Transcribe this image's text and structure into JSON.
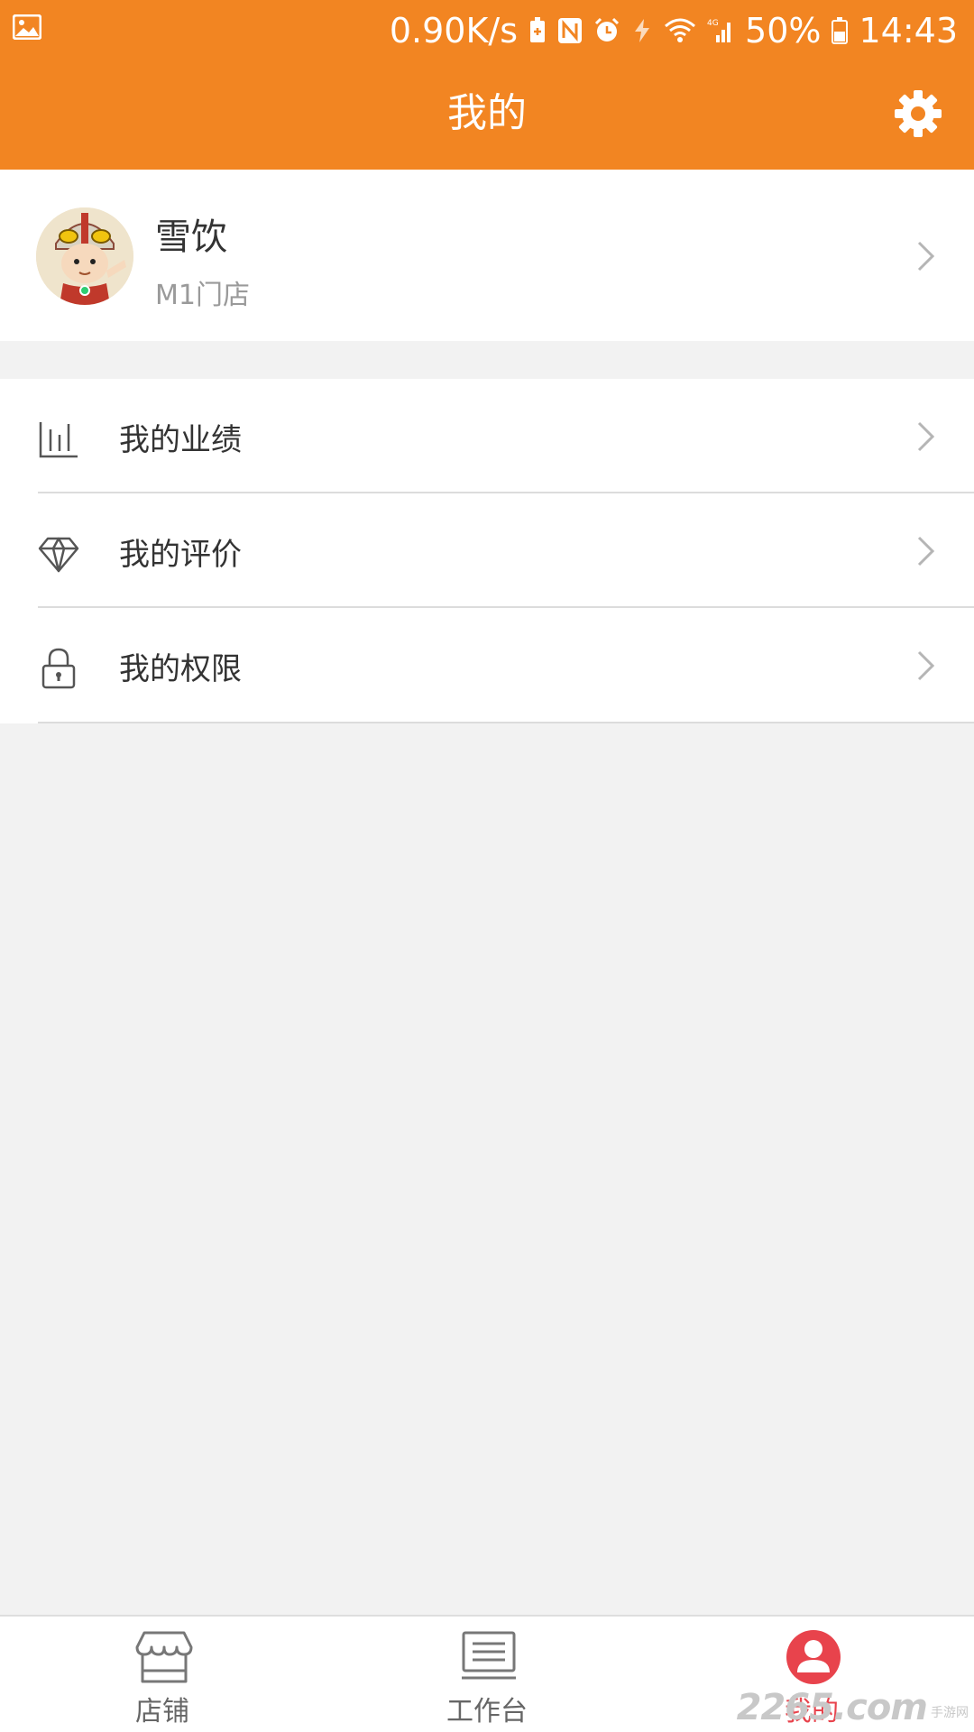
{
  "status_bar": {
    "speed": "0.90K/s",
    "battery_percent": "50%",
    "time": "14:43",
    "network": "4G",
    "icons": [
      "image-icon",
      "battery-saver-icon",
      "nfc-icon",
      "alarm-icon",
      "data-saver-icon",
      "wifi-icon",
      "signal-icon",
      "battery-icon"
    ]
  },
  "header": {
    "title": "我的",
    "settings_icon": "gear-icon",
    "background_color": "#f28522"
  },
  "profile": {
    "name": "雪饮",
    "store": "M1门店"
  },
  "menu": [
    {
      "label": "我的业绩",
      "icon": "bar-chart-icon"
    },
    {
      "label": "我的评价",
      "icon": "diamond-icon"
    },
    {
      "label": "我的权限",
      "icon": "lock-icon"
    }
  ],
  "bottom_nav": {
    "items": [
      {
        "label": "店铺",
        "icon": "store-icon",
        "active": false
      },
      {
        "label": "工作台",
        "icon": "laptop-icon",
        "active": false
      },
      {
        "label": "我的",
        "icon": "user-icon",
        "active": true
      }
    ],
    "active_color": "#e8434c"
  },
  "watermark": {
    "main": "2265.com",
    "sub": "手游网"
  }
}
